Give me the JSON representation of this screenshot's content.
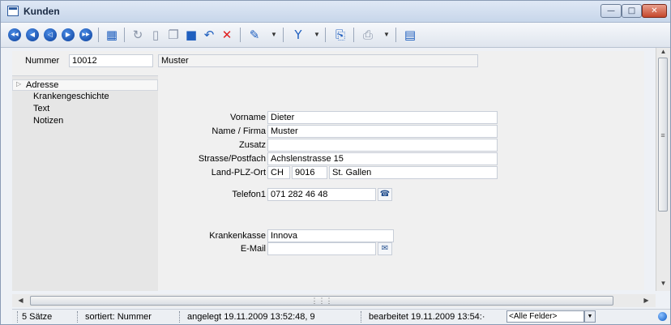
{
  "window": {
    "title": "Kunden",
    "minimize_glyph": "—",
    "maximize_glyph": "□",
    "close_glyph": "✕"
  },
  "toolbar": {
    "nav_first": "◀◀",
    "nav_prev_page": "◀",
    "nav_prev": "◁",
    "nav_next": "▶",
    "nav_last": "▶▶",
    "icons": [
      "table-view-icon",
      "refresh-icon",
      "new-record-icon",
      "copy-icon",
      "save-icon",
      "undo-icon",
      "delete-icon",
      "wand-icon",
      "filter-icon",
      "lookup-icon",
      "print-icon",
      "notes-icon"
    ]
  },
  "header": {
    "nummer_label": "Nummer",
    "nummer_value": "10012",
    "name_display": "Muster"
  },
  "sidebar": {
    "items": [
      {
        "label": "Adresse"
      },
      {
        "label": "Krankengeschichte"
      },
      {
        "label": "Text"
      },
      {
        "label": "Notizen"
      }
    ]
  },
  "form": {
    "vorname_label": "Vorname",
    "vorname_value": "Dieter",
    "name_label": "Name / Firma",
    "name_value": "Muster",
    "zusatz_label": "Zusatz",
    "zusatz_value": "",
    "strasse_label": "Strasse/Postfach",
    "strasse_value": "Achslenstrasse 15",
    "land_label": "Land-PLZ-Ort",
    "land_value": "CH",
    "plz_value": "9016",
    "ort_value": "St. Gallen",
    "telefon_label": "Telefon1",
    "telefon_value": "071 282 46 48",
    "krankenkasse_label": "Krankenkasse",
    "krankenkasse_value": "Innova",
    "email_label": "E-Mail",
    "email_value": ""
  },
  "status": {
    "count": "5 Sätze",
    "sorted": "sortiert: Nummer",
    "created": "angelegt 19.11.2009 13:52:48, 9",
    "edited": "bearbeitet 19.11.2009 13:54:·",
    "field_filter": "<Alle Felder>"
  }
}
